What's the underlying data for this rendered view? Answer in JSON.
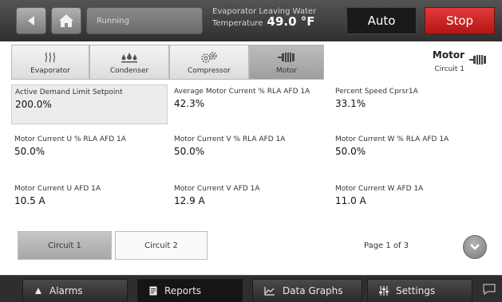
{
  "header": {
    "status": "Running",
    "temp_label_line1": "Evaporator Leaving Water",
    "temp_label_line2": "Temperature",
    "temp_value": "49.0 °F",
    "mode_label": "Auto",
    "stop_label": "Stop"
  },
  "tabs": [
    {
      "label": "Evaporator",
      "icon": "heat-waves-icon"
    },
    {
      "label": "Condenser",
      "icon": "droplets-icon"
    },
    {
      "label": "Compressor",
      "icon": "gears-icon"
    },
    {
      "label": "Motor",
      "icon": "motor-icon",
      "active": true
    }
  ],
  "section": {
    "title": "Motor",
    "subtitle": "Circuit 1"
  },
  "fields": [
    {
      "label": "Active Demand Limit Setpoint",
      "value": "200.0%"
    },
    {
      "label": "Average Motor Current % RLA AFD 1A",
      "value": "42.3%"
    },
    {
      "label": "Percent Speed Cprsr1A",
      "value": "33.1%"
    },
    {
      "label": "Motor Current U % RLA AFD 1A",
      "value": "50.0%"
    },
    {
      "label": "Motor Current V % RLA AFD 1A",
      "value": "50.0%"
    },
    {
      "label": "Motor Current W % RLA AFD 1A",
      "value": "50.0%"
    },
    {
      "label": "Motor Current U AFD 1A",
      "value": "10.5 A"
    },
    {
      "label": "Motor Current V AFD 1A",
      "value": "12.9 A"
    },
    {
      "label": "Motor Current W AFD 1A",
      "value": "11.0 A"
    }
  ],
  "circuits": [
    {
      "label": "Circuit 1",
      "active": true
    },
    {
      "label": "Circuit 2",
      "active": false
    }
  ],
  "pagination": {
    "label": "Page 1 of 3"
  },
  "nav": [
    {
      "label": "Alarms",
      "icon": "bell-icon"
    },
    {
      "label": "Reports",
      "icon": "report-icon"
    },
    {
      "label": "Data Graphs",
      "icon": "graph-icon"
    },
    {
      "label": "Settings",
      "icon": "sliders-icon"
    }
  ],
  "colors": {
    "stop": "#c92222",
    "header_bg": "#3c3c3c",
    "active_tab": "#a9a9a9"
  }
}
